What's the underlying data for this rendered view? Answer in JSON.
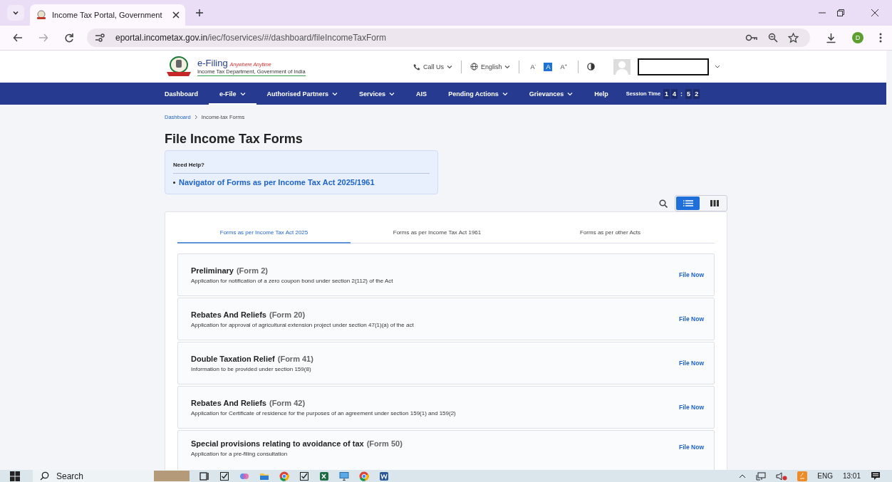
{
  "browser": {
    "tab_title": "Income Tax Portal, Government",
    "url_host": "eportal.incometax.gov.in",
    "url_path": "/iec/foservices/#/dashboard/fileIncomeTaxForm",
    "profile_initial": "D"
  },
  "header": {
    "brand": "e-Filing",
    "tagline": "Anywhere Anytime",
    "department": "Income Tax Department, Government of India",
    "call_us": "Call Us",
    "language": "English",
    "font_controls": [
      {
        "label": "A",
        "sup": "-",
        "selected": false
      },
      {
        "label": "A",
        "selected": true
      },
      {
        "label": "A",
        "sup": "+",
        "selected": false
      }
    ]
  },
  "nav": {
    "items": [
      {
        "label": "Dashboard",
        "has_menu": false,
        "selected": false
      },
      {
        "label": "e-File",
        "has_menu": true,
        "selected": true
      },
      {
        "label": "Authorised Partners",
        "has_menu": true,
        "selected": false
      },
      {
        "label": "Services",
        "has_menu": true,
        "selected": false
      },
      {
        "label": "AIS",
        "has_menu": false,
        "selected": false
      },
      {
        "label": "Pending Actions",
        "has_menu": true,
        "selected": false
      },
      {
        "label": "Grievances",
        "has_menu": true,
        "selected": false
      },
      {
        "label": "Help",
        "has_menu": false,
        "selected": false
      }
    ],
    "session_label": "Session Time",
    "session_digits": [
      "1",
      "4",
      ":",
      "5",
      "2"
    ]
  },
  "breadcrumb": [
    {
      "label": "Dashboard",
      "link": true
    },
    {
      "label": "Income-tax Forms",
      "link": false
    }
  ],
  "page_title": "File Income Tax Forms",
  "help": {
    "heading": "Need Help?",
    "links": [
      "Navigator of Forms as per Income Tax Act 2025/1961"
    ]
  },
  "view_toggle": [
    {
      "kind": "list",
      "selected": true
    },
    {
      "kind": "columns",
      "selected": false
    }
  ],
  "tabs": [
    {
      "label": "Forms as per Income Tax Act 2025",
      "selected": true
    },
    {
      "label": "Forms as per Income Tax Act 1961",
      "selected": false
    },
    {
      "label": "Forms as per other Acts",
      "selected": false
    }
  ],
  "forms": [
    {
      "title": "Preliminary",
      "form": "(Form 2)",
      "description": "Application for notification of a zero coupon bond under section 2(112) of the Act",
      "action": "File Now"
    },
    {
      "title": "Rebates And Reliefs",
      "form": "(Form 20)",
      "description": "Application for approval of agricultural extension project under section 47(1)(a) of the act",
      "action": "File Now"
    },
    {
      "title": "Double Taxation Relief",
      "form": "(Form 41)",
      "description": "Information to be provided under section 159(8)",
      "action": "File Now"
    },
    {
      "title": "Rebates And Reliefs",
      "form": "(Form 42)",
      "description": "Application for Certificate of residence for the purposes of an agreement under section 159(1) and 159(2)",
      "action": "File Now"
    },
    {
      "title": "Special provisions relating to avoidance of tax",
      "form": "(Form 50)",
      "description": "Application for a pre-filing consultation",
      "action": "File Now"
    }
  ],
  "taskbar": {
    "search": "Search",
    "language": "ENG",
    "time": "13:01"
  }
}
